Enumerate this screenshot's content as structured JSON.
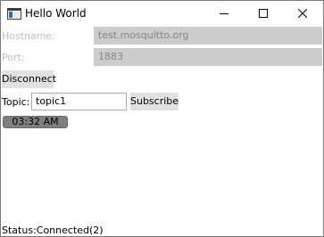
{
  "window": {
    "title": "Hello World",
    "icon": "window-app-icon",
    "controls": [
      "minimize-icon",
      "maximize-icon",
      "close-icon"
    ]
  },
  "connection": {
    "hostname_label": "Hostname:",
    "hostname_value": "test.mosquitto.org",
    "port_label": "Port:",
    "port_value": "1883",
    "disconnect_label": "Disconnect"
  },
  "subscription": {
    "topic_label": "Topic:",
    "topic_value": "topic1",
    "subscribe_label": "Subscribe"
  },
  "clock": {
    "time": "03:32 AM"
  },
  "status": {
    "text": "Status:Connected(2)"
  },
  "colors": {
    "disabled_field": "#cccccc",
    "disabled_text": "#bfbfbf",
    "button_face": "#e1e1e1",
    "clock_bar": "#7f7f7f"
  }
}
